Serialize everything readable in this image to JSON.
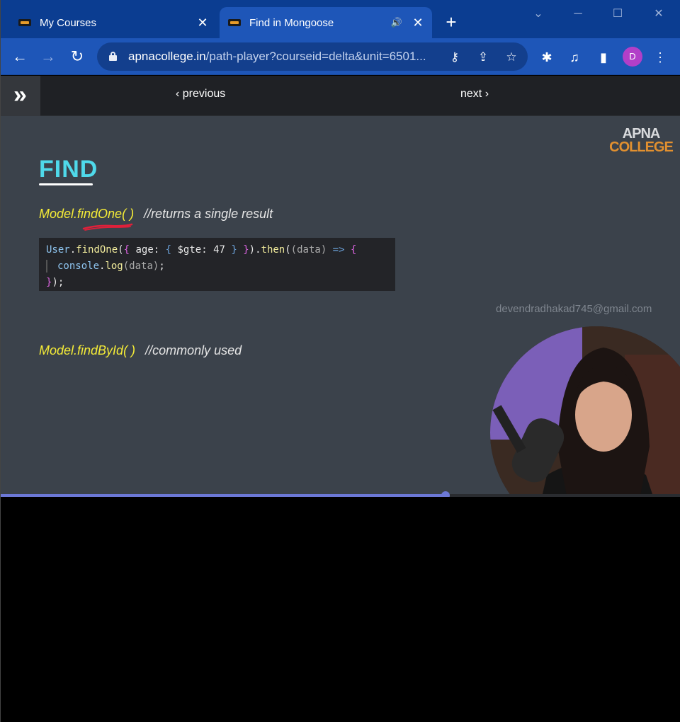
{
  "browser": {
    "tabs": [
      {
        "title": "My Courses",
        "active": false,
        "close": "✕"
      },
      {
        "title": "Find in Mongoose",
        "active": true,
        "close": "✕",
        "audio": "🔊"
      }
    ],
    "new_tab": "+",
    "window_controls": {
      "menu": "⌄",
      "minimize": "─",
      "maximize": "☐",
      "close": "✕"
    },
    "nav": {
      "back": "←",
      "forward": "→",
      "reload": "↻"
    },
    "address": {
      "domain": "apnacollege.in",
      "path": "/path-player?courseid=delta&unit=6501..."
    },
    "omnibox_icons": {
      "key": "⚷",
      "share": "⇪",
      "bookmark": "☆"
    },
    "toolbar_icons": {
      "extensions": "✱",
      "media": "♫",
      "sidepanel": "▮",
      "menu": "⋮"
    },
    "profile_initial": "D"
  },
  "course_nav": {
    "expand": "»",
    "previous": "‹ previous",
    "next": "next ›"
  },
  "slide": {
    "logo_line1": "APNA",
    "logo_line2": "COLLEGE",
    "title": "FIND",
    "line1_method": "Model.findOne( )",
    "line1_comment": "//returns a single result",
    "line2_method": "Model.findById( )",
    "line2_comment": "//commonly used",
    "watermark": "devendradhakad745@gmail.com"
  },
  "code": {
    "l1": {
      "obj": "User",
      "dot": ".",
      "fn": "findOne",
      "p1": "(",
      "b1": "{",
      "k": " age: ",
      "b2": "{",
      "op": " $gte: ",
      "num": "47",
      "b3": " }",
      "b4": " }",
      "p2": ").",
      "fn2": "then",
      "p3": "(",
      "arg": "(data)",
      "arrow": " => ",
      "b5": "{"
    },
    "l2": {
      "obj": "console",
      "dot": ".",
      "fn": "log",
      "arg": "(data)",
      "semi": ";"
    },
    "l3": {
      "b": "}",
      "end": ");"
    }
  },
  "video": {
    "progress": 0.655
  },
  "colors": {
    "tabbar": "#0b3d91",
    "toolbar": "#1e56b8",
    "slide_bg": "#3b424b",
    "title_cyan": "#4fd9ea",
    "method_yellow": "#f5ec37",
    "progress": "#6c78d6"
  }
}
